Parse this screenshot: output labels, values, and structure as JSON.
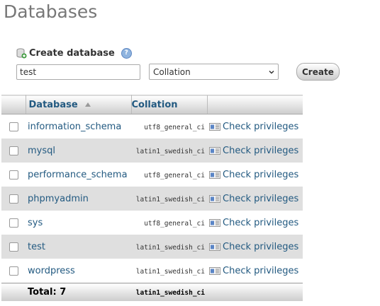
{
  "page": {
    "title": "Databases"
  },
  "create": {
    "title": "Create database",
    "name_value": "test",
    "collation_selected": "Collation",
    "button_label": "Create",
    "help_symbol": "?"
  },
  "table": {
    "headers": {
      "database": "Database",
      "collation": "Collation"
    },
    "rows": [
      {
        "name": "information_schema",
        "collation": "utf8_general_ci",
        "action": "Check privileges"
      },
      {
        "name": "mysql",
        "collation": "latin1_swedish_ci",
        "action": "Check privileges"
      },
      {
        "name": "performance_schema",
        "collation": "utf8_general_ci",
        "action": "Check privileges"
      },
      {
        "name": "phpmyadmin",
        "collation": "latin1_swedish_ci",
        "action": "Check privileges"
      },
      {
        "name": "sys",
        "collation": "utf8_general_ci",
        "action": "Check privileges"
      },
      {
        "name": "test",
        "collation": "latin1_swedish_ci",
        "action": "Check privileges"
      },
      {
        "name": "wordpress",
        "collation": "latin1_swedish_ci",
        "action": "Check privileges"
      }
    ],
    "total_label": "Total: 7",
    "total_collation": "latin1_swedish_ci"
  },
  "icons": {
    "create": "database-add-icon",
    "help": "help-icon",
    "sort": "sort-ascending-icon",
    "privileges": "check-privileges-icon",
    "select": "chevron-down-icon"
  },
  "colors": {
    "link": "#235a81",
    "row_alt": "#dfdfdf",
    "title": "#777777"
  }
}
